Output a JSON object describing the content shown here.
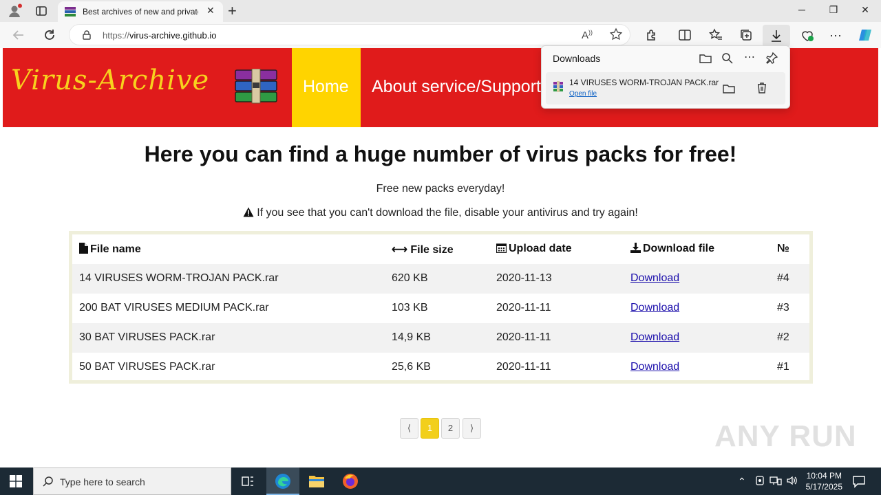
{
  "browser": {
    "tab_title": "Best archives of new and private",
    "url_prefix": "https://",
    "url_host": "virus-archive.github.io",
    "window_controls": {
      "minimize": "─",
      "restore": "❐",
      "close": "✕"
    }
  },
  "site": {
    "logo_text": "Virus-Archive",
    "nav": {
      "home": "Home",
      "about": "About service/Support"
    },
    "headline": "Here you can find a huge number of virus packs for free!",
    "subline": "Free new packs everyday!",
    "warning": "If you see that you can't download the file, disable your antivirus and try again!",
    "table": {
      "headers": [
        "File name",
        "File size",
        "Upload date",
        "Download file",
        "№"
      ],
      "rows": [
        [
          "14 VIRUSES WORM-TROJAN PACK.rar",
          "620 KB",
          "2020-11-13",
          "Download",
          "#4"
        ],
        [
          "200 BAT VIRUSES MEDIUM PACK.rar",
          "103 KB",
          "2020-11-11",
          "Download",
          "#3"
        ],
        [
          "30 BAT VIRUSES PACK.rar",
          "14,9 KB",
          "2020-11-11",
          "Download",
          "#2"
        ],
        [
          "50 BAT VIRUSES PACK.rar",
          "25,6 KB",
          "2020-11-11",
          "Download",
          "#1"
        ]
      ]
    },
    "pagination": {
      "prev": "⟨",
      "pages": [
        "1",
        "2"
      ],
      "next": "⟩",
      "current": "1"
    },
    "watermark": "ANY RUN"
  },
  "downloads_panel": {
    "title": "Downloads",
    "item_name": "14 VIRUSES WORM-TROJAN PACK.rar",
    "item_action": "Open file"
  },
  "taskbar": {
    "search_placeholder": "Type here to search",
    "time": "10:04 PM",
    "date": "5/17/2025"
  },
  "colors": {
    "header_red": "#e01b1b",
    "nav_yellow": "#ffd400",
    "logo_yellow": "#f7d21e",
    "link_blue": "#1a0dab",
    "pager_active": "#f2cf1b",
    "taskbar": "#1c2a35"
  }
}
